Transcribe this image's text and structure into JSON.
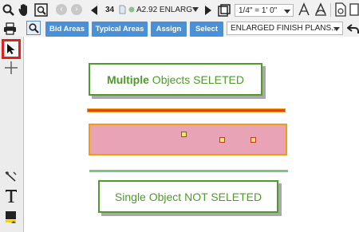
{
  "toolbar": {
    "page_number": "34",
    "sheet_label": "A2.92 ENLARG",
    "scale_value": "1/4\" = 1' 0\"",
    "bid_areas_label": "Bid Areas",
    "typical_areas_label": "Typical Areas",
    "assign_label": "Assign",
    "select_label": "Select",
    "page_filter_value": "ENLARGED FINISH PLANS..."
  },
  "canvas": {
    "multiple_label_bold": "Multiple",
    "multiple_label_rest": " Objects SELETED",
    "single_label": "Single Object NOT SELETED"
  },
  "colors": {
    "accent_blue": "#4a90d9",
    "callout_green": "#4e9b2c",
    "selection_orange": "#f39c12",
    "highlight_red": "#e02020",
    "area_fill_pink": "#e8a3b6",
    "line_green": "#7cc57c"
  },
  "icons": [
    "search-icon",
    "hand-pan-icon",
    "zoom-window-icon",
    "back-icon",
    "forward-icon",
    "prev-page-icon",
    "page-icon",
    "next-page-icon",
    "page-layout-icon",
    "dimension-icon",
    "angle-icon",
    "export-icon",
    "print-icon",
    "zoom-fit-icon",
    "undo-icon",
    "select-arrow-icon",
    "crosshair-icon",
    "measure-icon",
    "text-tool-icon",
    "color-swatch-icon"
  ]
}
